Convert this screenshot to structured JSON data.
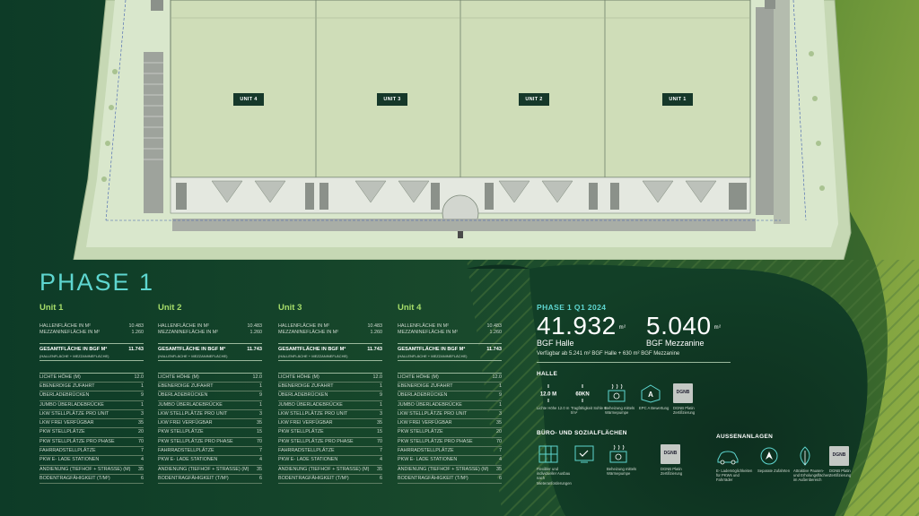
{
  "phase_title": "PHASE 1",
  "site_plan": {
    "unit_labels": [
      "UNIT 4",
      "UNIT 3",
      "UNIT 2",
      "UNIT 1"
    ]
  },
  "units": [
    {
      "title": "Unit 1",
      "hallenflaeche_label": "HALLENFLÄCHE IN M²",
      "hallenflaeche_value": "10.483",
      "mezzanine_label": "MEZZANINEFLÄCHE IN M²",
      "mezzanine_value": "1.260",
      "gesamt_label": "GESAMTFLÄCHE IN BGF M²",
      "gesamt_value": "11.743",
      "gesamt_sub": "(HALLENFLÄCHE + MEZZANINEFLÄCHE)",
      "specs": [
        {
          "label": "LICHTE HÖHE (M)",
          "value": "12.0"
        },
        {
          "label": "EBENERDIGE ZUFAHRT",
          "value": "1"
        },
        {
          "label": "ÜBERLADEBRÜCKEN",
          "value": "9"
        },
        {
          "label": "JUMBO ÜBERLADEBRÜCKE",
          "value": "1"
        },
        {
          "label": "LKW STELLPLÄTZE PRO UNIT",
          "value": "3"
        },
        {
          "label": "LKW FREI VERFÜGBAR",
          "value": "35"
        },
        {
          "label": "PKW STELLPLÄTZE",
          "value": "20"
        },
        {
          "label": "PKW STELLPLÄTZE PRO PHASE",
          "value": "70"
        },
        {
          "label": "FAHRRADSTELLPLÄTZE",
          "value": "7"
        },
        {
          "label": "PKW E- LADE STATIONEN",
          "value": "4"
        },
        {
          "label": "ANDIENUNG (TIEFHOF + STRASSE) (M)",
          "value": "35"
        },
        {
          "label": "BODENTRAGFÄHIGKEIT (T/M²)",
          "value": "6"
        }
      ]
    },
    {
      "title": "Unit 2",
      "hallenflaeche_label": "HALLENFLÄCHE IN M²",
      "hallenflaeche_value": "10.483",
      "mezzanine_label": "MEZZANINEFLÄCHE IN M²",
      "mezzanine_value": "1.260",
      "gesamt_label": "GESAMTFLÄCHE IN BGF M²",
      "gesamt_value": "11.743",
      "gesamt_sub": "(HALLENFLÄCHE + MEZZANINEFLÄCHE)",
      "specs": [
        {
          "label": "LICHTE HÖHE (M)",
          "value": "12.0"
        },
        {
          "label": "EBENERDIGE ZUFAHRT",
          "value": "1"
        },
        {
          "label": "ÜBERLADEBRÜCKEN",
          "value": "9"
        },
        {
          "label": "JUMBO ÜBERLADEBRÜCKE",
          "value": "1"
        },
        {
          "label": "LKW STELLPLÄTZE PRO UNIT",
          "value": "3"
        },
        {
          "label": "LKW FREI VERFÜGBAR",
          "value": "35"
        },
        {
          "label": "PKW STELLPLÄTZE",
          "value": "15"
        },
        {
          "label": "PKW STELLPLÄTZE PRO PHASE",
          "value": "70"
        },
        {
          "label": "FAHRRADSTELLPLÄTZE",
          "value": "7"
        },
        {
          "label": "PKW E- LADE STATIONEN",
          "value": "4"
        },
        {
          "label": "ANDIENUNG (TIEFHOF + STRASSE) (M)",
          "value": "35"
        },
        {
          "label": "BODENTRAGFÄHIGKEIT (T/M²)",
          "value": "6"
        }
      ]
    },
    {
      "title": "Unit 3",
      "hallenflaeche_label": "HALLENFLÄCHE IN M²",
      "hallenflaeche_value": "10.483",
      "mezzanine_label": "MEZZANINEFLÄCHE IN M²",
      "mezzanine_value": "1.260",
      "gesamt_label": "GESAMTFLÄCHE IN BGF M²",
      "gesamt_value": "11.743",
      "gesamt_sub": "(HALLENFLÄCHE + MEZZANINEFLÄCHE)",
      "specs": [
        {
          "label": "LICHTE HÖHE (M)",
          "value": "12.0"
        },
        {
          "label": "EBENERDIGE ZUFAHRT",
          "value": "1"
        },
        {
          "label": "ÜBERLADEBRÜCKEN",
          "value": "9"
        },
        {
          "label": "JUMBO ÜBERLADEBRÜCKE",
          "value": "1"
        },
        {
          "label": "LKW STELLPLÄTZE PRO UNIT",
          "value": "3"
        },
        {
          "label": "LKW FREI VERFÜGBAR",
          "value": "35"
        },
        {
          "label": "PKW STELLPLÄTZE",
          "value": "15"
        },
        {
          "label": "PKW STELLPLÄTZE PRO PHASE",
          "value": "70"
        },
        {
          "label": "FAHRRADSTELLPLÄTZE",
          "value": "7"
        },
        {
          "label": "PKW E- LADE STATIONEN",
          "value": "4"
        },
        {
          "label": "ANDIENUNG (TIEFHOF + STRASSE) (M)",
          "value": "35"
        },
        {
          "label": "BODENTRAGFÄHIGKEIT (T/M²)",
          "value": "6"
        }
      ]
    },
    {
      "title": "Unit 4",
      "hallenflaeche_label": "HALLENFLÄCHE IN M²",
      "hallenflaeche_value": "10.483",
      "mezzanine_label": "MEZZANINEFLÄCHE IN M²",
      "mezzanine_value": "1.260",
      "gesamt_label": "GESAMTFLÄCHE IN BGF M²",
      "gesamt_value": "11.743",
      "gesamt_sub": "(HALLENFLÄCHE + MEZZANINEFLÄCHE)",
      "specs": [
        {
          "label": "LICHTE HÖHE (M)",
          "value": "12.0"
        },
        {
          "label": "EBENERDIGE ZUFAHRT",
          "value": "1"
        },
        {
          "label": "ÜBERLADEBRÜCKEN",
          "value": "9"
        },
        {
          "label": "JUMBO ÜBERLADEBRÜCKE",
          "value": "1"
        },
        {
          "label": "LKW STELLPLÄTZE PRO UNIT",
          "value": "3"
        },
        {
          "label": "LKW FREI VERFÜGBAR",
          "value": "35"
        },
        {
          "label": "PKW STELLPLÄTZE",
          "value": "20"
        },
        {
          "label": "PKW STELLPLÄTZE PRO PHASE",
          "value": "70"
        },
        {
          "label": "FAHRRADSTELLPLÄTZE",
          "value": "7"
        },
        {
          "label": "PKW E- LADE STATIONEN",
          "value": "4"
        },
        {
          "label": "ANDIENUNG (TIEFHOF + STRASSE) (M)",
          "value": "35"
        },
        {
          "label": "BODENTRAGFÄHIGKEIT (T/M²)",
          "value": "6"
        }
      ]
    }
  ],
  "summary": {
    "phase_label": "PHASE 1 Q1 2024",
    "halle_value": "41.932",
    "halle_unit": "m²",
    "halle_label": "BGF Halle",
    "mezz_value": "5.040",
    "mezz_unit": "m²",
    "mezz_label": "BGF Mezzanine",
    "verfuegbar": "Verfügbar ab 5.241 m² BGF Halle + 630 m² BGF Mezzanine"
  },
  "halle": {
    "heading": "HALLE",
    "items": [
      {
        "icon": "height-12m-icon",
        "badge": "12.0 M",
        "text": "Lichte Höhe 12.0 m"
      },
      {
        "icon": "load-60kn-icon",
        "badge": "60KN",
        "text": "Tragfähigkeit Sohle 6 t/m²"
      },
      {
        "icon": "heat-pump-icon",
        "text": "Beheizung mittels Wärmepumpe"
      },
      {
        "icon": "epc-a-icon",
        "badge": "A",
        "text": "EPC A Bewertung"
      },
      {
        "icon": "dgnb-icon",
        "badge": "DGNB",
        "text": "DGNB Platin Zertifizierung"
      }
    ]
  },
  "buero": {
    "heading": "BÜRO- UND SOZIALFLÄCHEN",
    "items": [
      {
        "icon": "grid-layout-icon",
        "text": "Flexibler und individueller Ausbau nach Mieteranforderungen"
      },
      {
        "icon": "checklist-icon",
        "text": ""
      },
      {
        "icon": "heat-pump-icon",
        "text": "Beheizung mittels Wärmepumpe"
      },
      {
        "icon": "dgnb-icon",
        "badge": "DGNB",
        "text": "DGNB Platin Zertifizierung"
      }
    ]
  },
  "aussen": {
    "heading": "AUSSENANLAGEN",
    "items": [
      {
        "icon": "ev-car-icon",
        "text": "E- Lademöglichkeiten für PKWs und Fahrräder"
      },
      {
        "icon": "navigation-icon",
        "text": "Separate Zufahrten"
      },
      {
        "icon": "leaf-icon",
        "text": "Attraktive Pausen- und Erholungsflächen im Außenbereich"
      },
      {
        "icon": "dgnb-icon",
        "badge": "DGNB",
        "text": "DGNB Platin Zertifizierung"
      }
    ]
  },
  "colors": {
    "accent_cyan": "#5ed6d0",
    "accent_green": "#a6dd6a",
    "dark_green": "#0f3a24",
    "olive_green": "#7a9a3e"
  }
}
